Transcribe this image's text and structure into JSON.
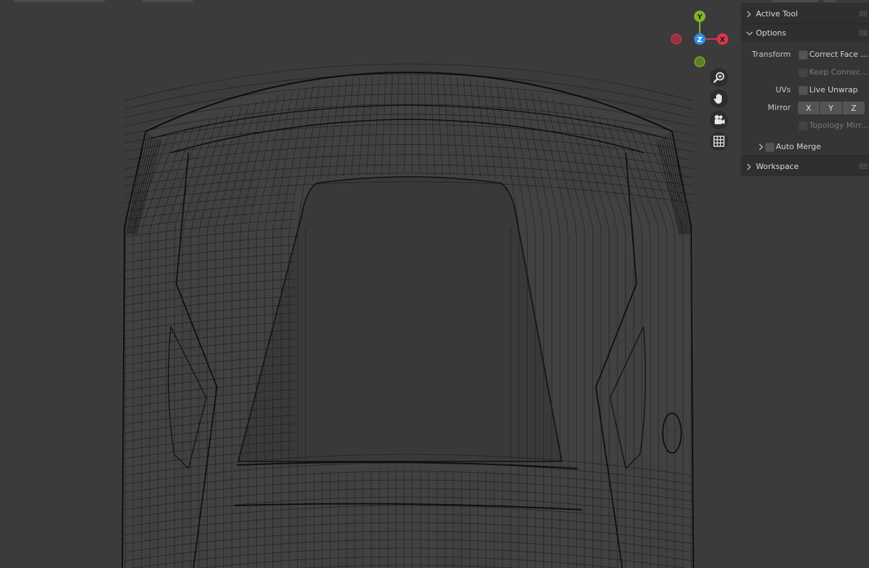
{
  "viewport": {
    "gizmo": {
      "x_label": "X",
      "y_label": "Y",
      "z_label": "Z",
      "colors": {
        "x": "#e0344e",
        "y": "#7fb626",
        "z": "#2f8ee6",
        "x_neg": "#963241",
        "y_neg": "#5f7c29"
      }
    },
    "nav_icons": [
      "zoom-icon",
      "hand-pan-icon",
      "camera-icon",
      "grid-icon"
    ]
  },
  "sidebar": {
    "active_tool": {
      "title": "Active Tool"
    },
    "options": {
      "title": "Options",
      "transform_label": "Transform",
      "correct_face": "Correct Face ...",
      "keep_connected": "Keep Connec...",
      "uvs_label": "UVs",
      "live_unwrap": "Live Unwrap",
      "mirror_label": "Mirror",
      "mirror_axes": {
        "x": "X",
        "y": "Y",
        "z": "Z"
      },
      "topology_mirror": "Topology Mirr...",
      "auto_merge": "Auto Merge"
    },
    "workspace": {
      "title": "Workspace"
    }
  }
}
